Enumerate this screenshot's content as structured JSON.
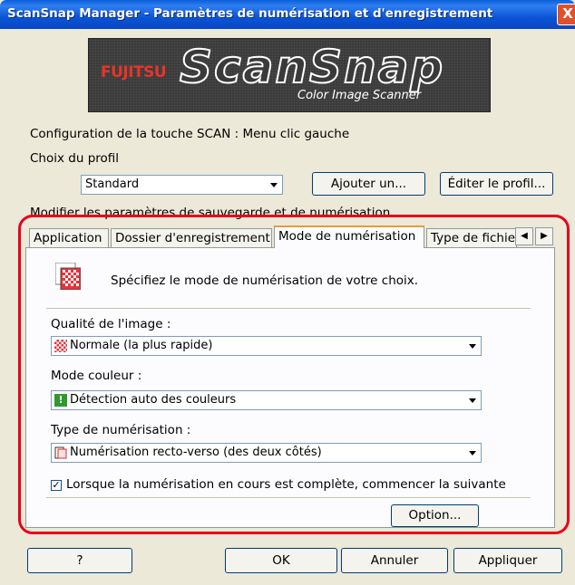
{
  "window": {
    "title": "ScanSnap Manager - Paramètres de numérisation et d'enregistrement",
    "close": "X"
  },
  "banner": {
    "brand": "FUJITSU",
    "logo": "ScanSnap",
    "subtitle": "Color Image Scanner"
  },
  "config_label": "Configuration de la touche SCAN : Menu clic gauche",
  "profile": {
    "label": "Choix du profil",
    "selected": "Standard",
    "add_button": "Ajouter un...",
    "edit_button": "Éditer le profil..."
  },
  "modify_label": "Modifier les paramètres de sauvegarde et de numérisation",
  "tabs": [
    {
      "label": "Application"
    },
    {
      "label": "Dossier d'enregistrement"
    },
    {
      "label": "Mode de numérisation"
    },
    {
      "label": "Type de fichier"
    }
  ],
  "panel": {
    "description": "Spécifiez le mode de numérisation de votre choix.",
    "quality": {
      "label": "Qualité de l'image :",
      "selected": "Normale (la plus rapide)"
    },
    "color": {
      "label": "Mode couleur :",
      "selected": "Détection auto des couleurs"
    },
    "scan_type": {
      "label": "Type de numérisation :",
      "selected": "Numérisation recto-verso (des deux côtés)"
    },
    "continue_checkbox": {
      "label": "Lorsque la numérisation en cours est complète, commencer la suivante",
      "checked": true
    },
    "option_button": "Option..."
  },
  "footer": {
    "help": "?",
    "ok": "OK",
    "cancel": "Annuler",
    "apply": "Appliquer"
  },
  "colors": {
    "highlight": "#e8001c",
    "titlebar": "#0a5ed8",
    "tab_active": "#e89b3d"
  }
}
